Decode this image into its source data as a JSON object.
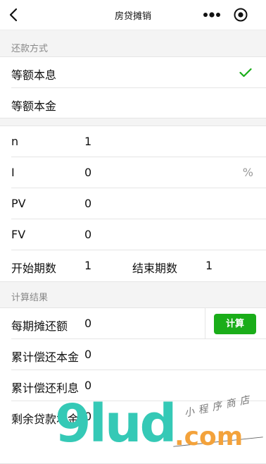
{
  "nav": {
    "title": "房贷摊销"
  },
  "repayment_method": {
    "section_label": "还款方式",
    "options": [
      {
        "label": "等额本息",
        "selected": true
      },
      {
        "label": "等额本金",
        "selected": false
      }
    ]
  },
  "inputs": {
    "n": {
      "label": "n",
      "value": "1"
    },
    "i": {
      "label": "I",
      "value": "0",
      "unit": "%"
    },
    "pv": {
      "label": "PV",
      "value": "0"
    },
    "fv": {
      "label": "FV",
      "value": "0"
    },
    "start_period": {
      "label": "开始期数",
      "value": "1"
    },
    "end_period": {
      "label": "结束期数",
      "value": "1"
    }
  },
  "results": {
    "section_label": "计算结果",
    "per_period_payment": {
      "label": "每期摊还额",
      "value": "0"
    },
    "calc_button": "计算",
    "cumulative_principal": {
      "label": "累计偿还本金",
      "value": "0"
    },
    "cumulative_interest": {
      "label": "累计偿还利息",
      "value": "0"
    },
    "remaining_principal": {
      "label": "剩余贷款本金",
      "value": "0"
    }
  },
  "watermark": {
    "brand": "9lud",
    "domain": ".com",
    "tagline": "小程序商店"
  },
  "colors": {
    "accent_green": "#1aad19",
    "check_green": "#1aad19"
  },
  "icons": {
    "back": "chevron-left-icon",
    "more": "more-dots-icon",
    "target": "target-icon",
    "check": "checkmark-icon"
  }
}
